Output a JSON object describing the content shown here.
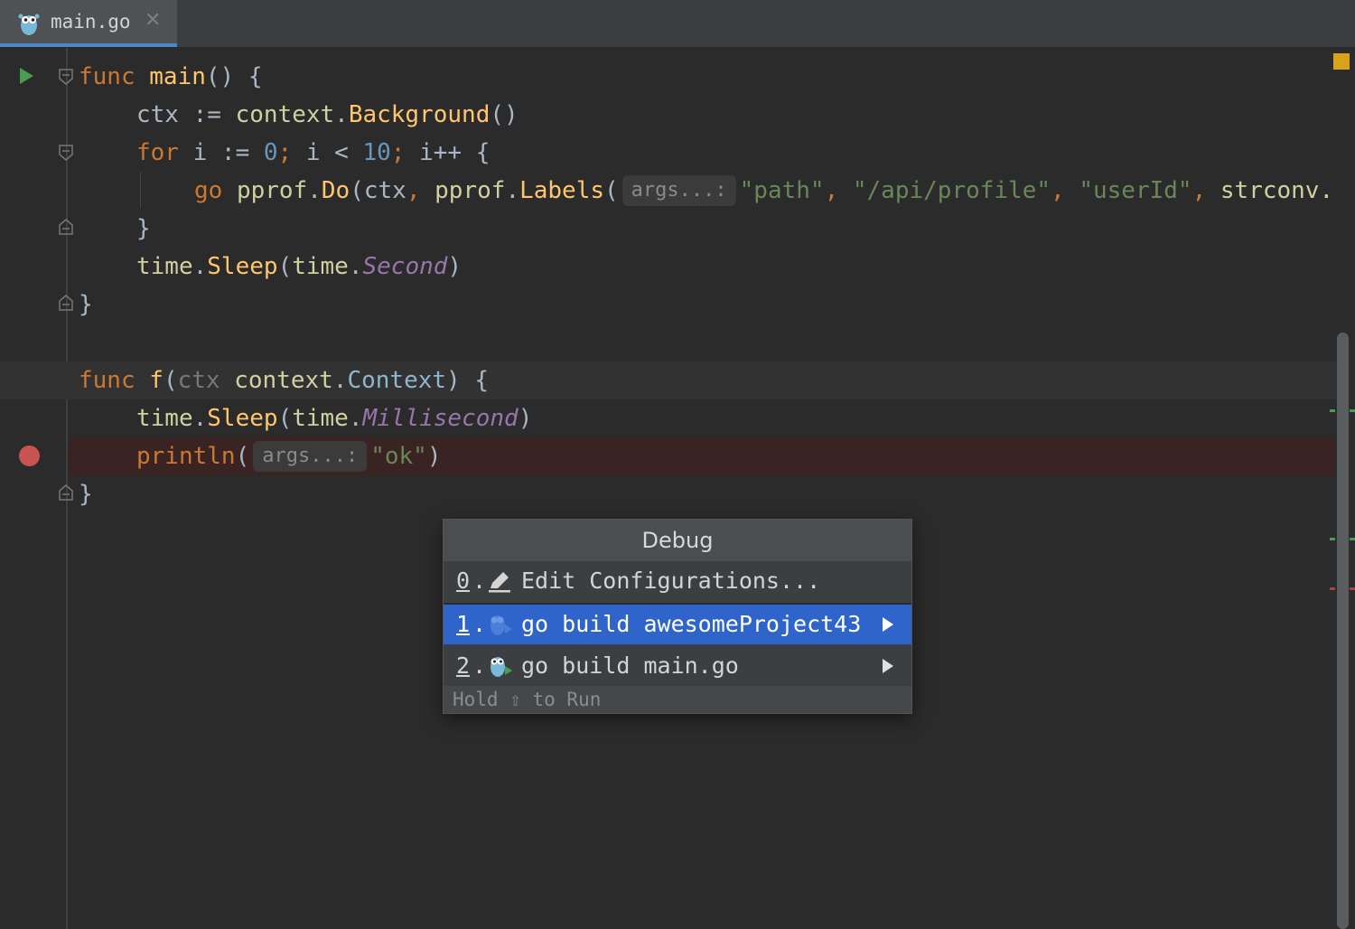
{
  "tab": {
    "label": "main.go",
    "close": "✕"
  },
  "code": {
    "l1": {
      "kw": "func",
      "fn": "main",
      "rest": "() {"
    },
    "l2": {
      "a": "ctx := ",
      "pkg": "context",
      "dot": ".",
      "fn": "Background",
      "rest": "()"
    },
    "l3": {
      "kw": "for",
      "a": " i := ",
      "n1": "0",
      "semi1": ";",
      "b": " i < ",
      "n2": "10",
      "semi2": ";",
      "c": " i++ {"
    },
    "l4": {
      "kw": "go",
      "pkg1": "pprof",
      "fn1": "Do",
      "a": "(ctx",
      "comma1": ",",
      "pkg2": "pprof",
      "fn2": "Labels",
      "p": "(",
      "hint": "args...:",
      "s1": "\"path\"",
      "c1": ",",
      "s2": "\"/api/profile\"",
      "c2": ",",
      "s3": "\"userId\"",
      "c3": ",",
      "tail": "strconv."
    },
    "l5": {
      "text": "}"
    },
    "l6": {
      "pkg1": "time",
      "fn": "Sleep",
      "p": "(",
      "pkg2": "time",
      "cst": "Second",
      "e": ")"
    },
    "l7": {
      "text": "}"
    },
    "l9": {
      "kw": "func",
      "fn": "f",
      "p1": "(",
      "par": "ctx",
      "pkg": "context",
      "typ": "Context",
      "e": ") {"
    },
    "l10": {
      "pkg1": "time",
      "fn": "Sleep",
      "p": "(",
      "pkg2": "time",
      "cst": "Millisecond",
      "e": ")"
    },
    "l11": {
      "fn": "println",
      "p": "(",
      "hint": "args...:",
      "s": "\"ok\"",
      "e": ")"
    },
    "l12": {
      "text": "}"
    }
  },
  "popup": {
    "title": "Debug",
    "items": [
      {
        "num": "0",
        "dot": ".",
        "label": "Edit Configurations...",
        "icon": "pencil-icon"
      },
      {
        "num": "1",
        "dot": ".",
        "label": "go build awesomeProject43",
        "icon": "gopher-run-icon",
        "selected": true
      },
      {
        "num": "2",
        "dot": ".",
        "label": "go build main.go",
        "icon": "gopher-run-icon"
      }
    ],
    "footer": "Hold ⇧ to Run"
  },
  "colors": {
    "accent": "#2f65ca",
    "breakpoint": "#c75450",
    "run": "#499c54",
    "warning": "#d9a21c"
  }
}
